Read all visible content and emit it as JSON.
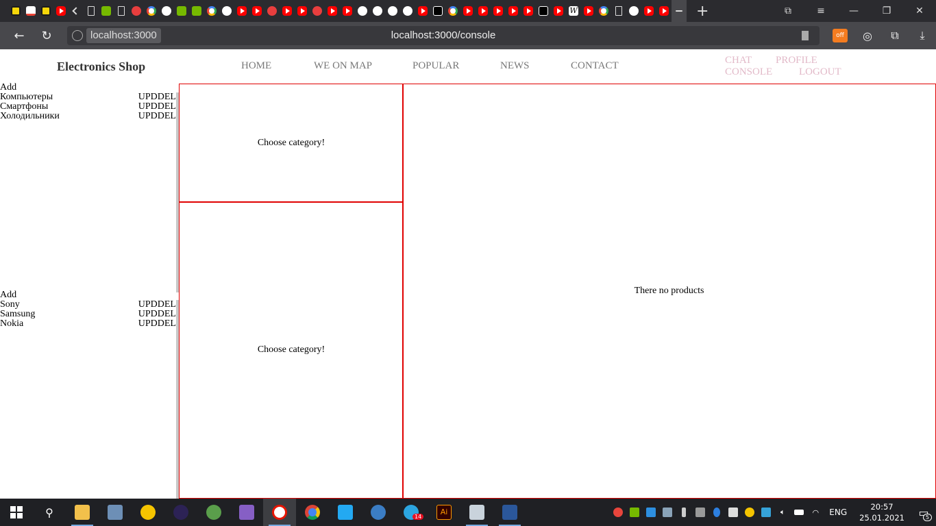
{
  "browser": {
    "url_host": "localhost:3000",
    "url_full": "localhost:3000/console",
    "new_tab": "+",
    "ext_off_label": "off"
  },
  "site": {
    "brand": "Electronics Shop",
    "nav": [
      "HOME",
      "WE ON MAP",
      "POPULAR",
      "NEWS",
      "CONTACT"
    ],
    "user_nav": [
      "CHAT",
      "PROFILE",
      "CONSOLE",
      "LOGOUT"
    ],
    "nav_color": "#777777",
    "user_nav_color": "#e2b9c8"
  },
  "categories": {
    "add_label": "Add",
    "items": [
      {
        "name": "Компьютеры",
        "actions": "UPDDEL"
      },
      {
        "name": "Смартфоны",
        "actions": "UPDDEL"
      },
      {
        "name": "Холодильники",
        "actions": "UPDDEL"
      }
    ]
  },
  "brands": {
    "add_label": "Add",
    "items": [
      {
        "name": "Sony",
        "actions": "UPDDEL"
      },
      {
        "name": "Samsung",
        "actions": "UPDDEL"
      },
      {
        "name": "Nokia",
        "actions": "UPDDEL"
      }
    ]
  },
  "panels": {
    "top_message": "Choose category!",
    "bottom_message": "Choose category!",
    "products_message": "There no products",
    "border_color": "#e00000"
  },
  "taskbar": {
    "lang": "ENG",
    "time": "20:57",
    "date": "25.01.2021",
    "telegram_badge": "14",
    "notifications": "5",
    "illustrator_label": "Ai"
  }
}
